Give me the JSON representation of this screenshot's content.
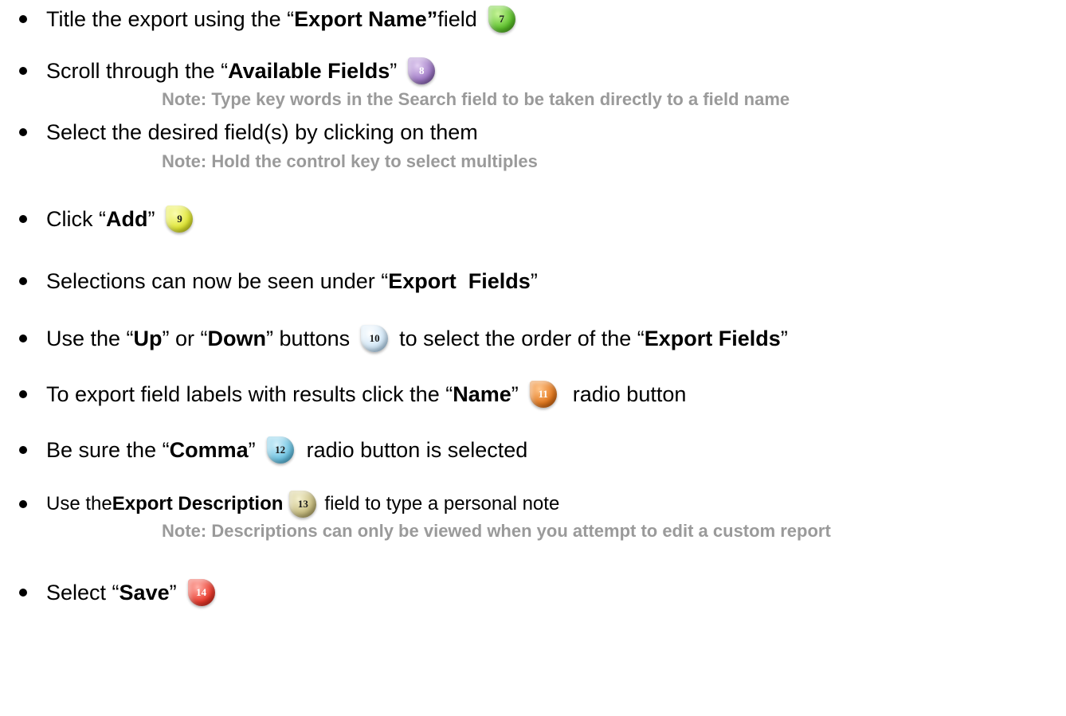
{
  "items": [
    {
      "pre": "Title the export using the “",
      "bold1": "Export Name”",
      "mid": " field",
      "badge": "7"
    },
    {
      "pre": "Scroll through the “",
      "bold1": "Available Fields",
      "post": "”",
      "badge": "8",
      "note": "Note: Type key words in the Search field to be taken directly to a field name"
    },
    {
      "pre": "Select the desired field(s) by clicking on them",
      "note": "Note: Hold the control key to select multiples"
    },
    {
      "pre": "Click “",
      "bold1": "Add",
      "post": "”",
      "badge": "9"
    },
    {
      "pre": "Selections can now be seen under “",
      "bold1": "Export  Fields",
      "post": "”"
    },
    {
      "pre": "Use the “",
      "bold1": "Up",
      "mid1": "” or “",
      "bold2": "Down",
      "mid2": "” buttons",
      "badge": "10",
      "mid3": "to select the order of the “",
      "bold3": "Export Fields",
      "post": "”"
    },
    {
      "pre": "To export field labels with results click the “",
      "bold1": "Name",
      "post": "”",
      "badge": "11",
      "after": "radio button"
    },
    {
      "pre": "Be sure the “",
      "bold1": "Comma",
      "post": "”",
      "badge": "12",
      "after": "radio button is selected"
    },
    {
      "pre": "Use the ",
      "bold1": "Export Description",
      "badge": "13",
      "after": "field to type a personal note",
      "note": "Note: Descriptions can only be viewed when you attempt to edit a custom report"
    },
    {
      "pre": "Select “",
      "bold1": "Save",
      "post": "”",
      "badge": "14"
    }
  ],
  "badge_colors": {
    "7": "#5cc12b",
    "8": "#9d77c4",
    "9": "#dfe632",
    "10": "#cfe6f7",
    "11": "#e2781e",
    "12": "#6cc3e2",
    "13": "#c8bd7f",
    "14": "#ea3a2c"
  }
}
